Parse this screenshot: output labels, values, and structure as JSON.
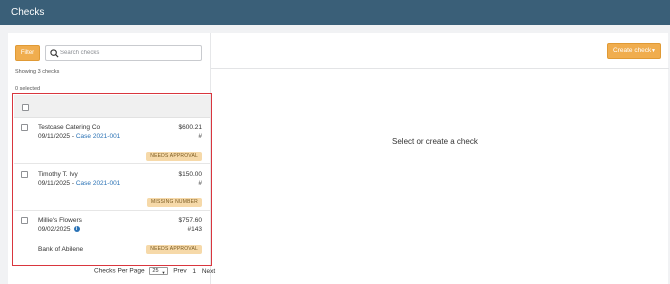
{
  "header": {
    "title": "Checks"
  },
  "toolbar": {
    "filter_label": "Filter",
    "search_placeholder": "Search checks",
    "create_label": "Create check"
  },
  "summary": {
    "showing": "Showing 3 checks",
    "selected": "0 selected"
  },
  "checks": [
    {
      "payee": "Testcase Catering Co",
      "date": "09/11/2025",
      "separator": " - ",
      "case": "Case 2021-001",
      "amount": "$600.21",
      "check_number": "#",
      "status": "NEEDS APPROVAL"
    },
    {
      "payee": "Timothy T. Ivy",
      "date": "09/11/2025",
      "separator": " - ",
      "case": "Case 2021-001",
      "amount": "$150.00",
      "check_number": "#",
      "status": "MISSING NUMBER"
    },
    {
      "payee": "Millie's Flowers",
      "date": "09/02/2025",
      "amount": "$757.60",
      "check_number": "#143",
      "bank": "Bank of Abilene",
      "status": "NEEDS APPROVAL",
      "info_glyph": "i"
    }
  ],
  "pagination": {
    "per_page_label": "Checks Per Page",
    "per_page_value": "25",
    "prev_label": "Prev",
    "current_page": "1",
    "next_label": "Next"
  },
  "detail": {
    "empty_message": "Select or create a check"
  },
  "colors": {
    "header": "#3a5f78",
    "accent": "#f0ad4e",
    "link": "#2a72b5",
    "badge": "#f6d9a9",
    "outline": "#d9363e"
  }
}
